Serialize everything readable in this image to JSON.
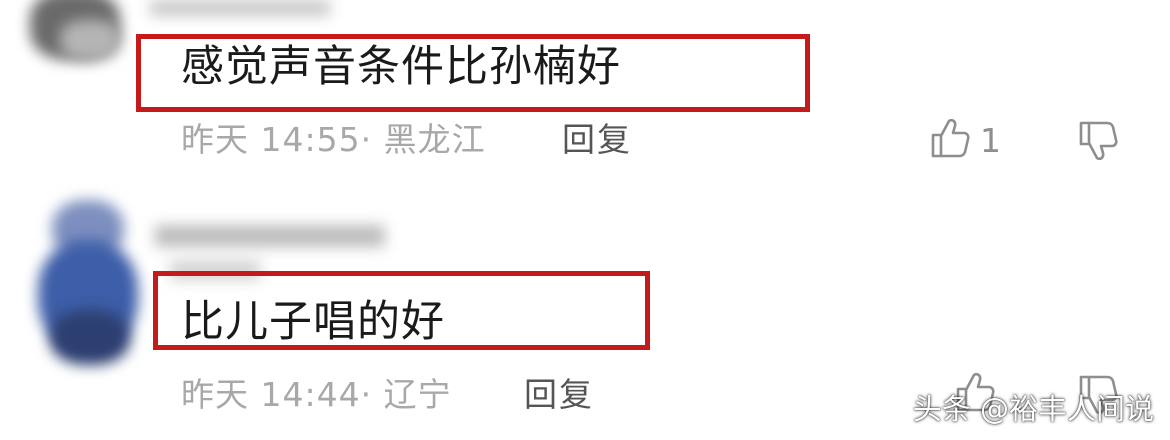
{
  "comments": [
    {
      "text": "感觉声音条件比孙楠好",
      "time": "昨天 14:55",
      "location": "黑龙江",
      "reply_label": "回复",
      "like_count": "1"
    },
    {
      "text": "比儿子唱的好",
      "time": "昨天 14:44",
      "location": "辽宁",
      "reply_label": "回复",
      "like_count": ""
    }
  ],
  "separator": "·",
  "watermark": "头条 @裕丰人间说",
  "icons": {
    "like": "thumbs-up-icon",
    "dislike": "thumbs-down-icon"
  },
  "colors": {
    "highlight_border": "#c41a1a",
    "meta_text": "#a8a8a8",
    "reply_text": "#555555"
  }
}
